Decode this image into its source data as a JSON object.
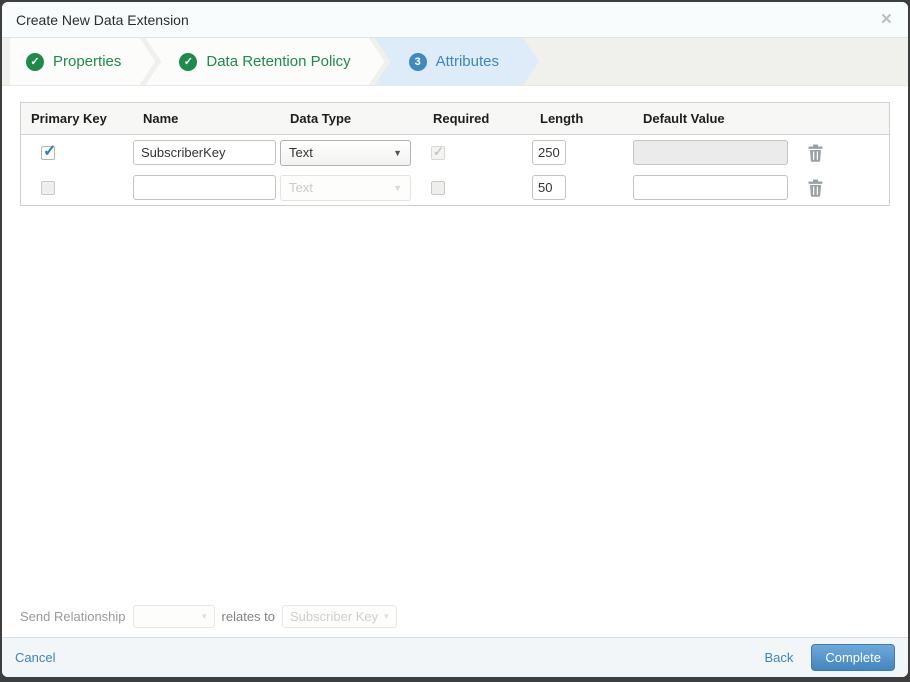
{
  "modal": {
    "title": "Create New Data Extension",
    "close_icon": "×"
  },
  "steps": [
    {
      "label": "Properties",
      "status": "complete",
      "badge": "✓"
    },
    {
      "label": "Data Retention Policy",
      "status": "complete",
      "badge": "✓"
    },
    {
      "label": "Attributes",
      "status": "active",
      "badge": "3"
    }
  ],
  "table": {
    "headers": [
      "Primary Key",
      "Name",
      "Data Type",
      "Required",
      "Length",
      "Default Value",
      ""
    ],
    "rows": [
      {
        "primary_key": "checked",
        "name": "SubscriberKey",
        "data_type": "Text",
        "required": "checked-disabled",
        "length": "250",
        "default_value": "",
        "default_value_disabled": true
      },
      {
        "primary_key": "unchecked",
        "name": "",
        "data_type": "Text",
        "data_type_disabled": true,
        "required": "unchecked",
        "length": "50",
        "default_value": "",
        "default_value_disabled": false
      }
    ]
  },
  "send_relationship": {
    "label": "Send Relationship",
    "relates_to_label": "relates to",
    "relates_to_value": "Subscriber Key",
    "caret": "▾"
  },
  "footer": {
    "cancel_label": "Cancel",
    "back_label": "Back",
    "complete_label": "Complete"
  },
  "colors": {
    "step_complete_green": "#1f8a4c",
    "step_active_blue": "#4187c0",
    "step_active_fill": "#ddecf8",
    "accent_link_blue": "#3d85b8",
    "complete_button_blue": "#4385bf"
  }
}
